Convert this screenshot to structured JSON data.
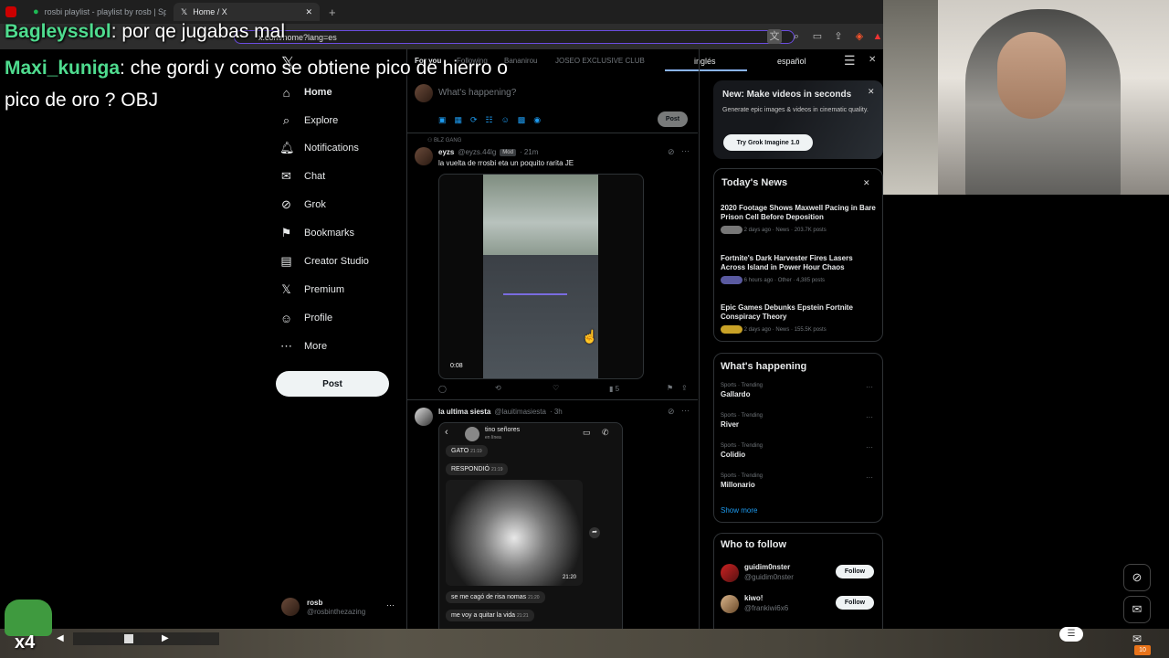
{
  "browser": {
    "tabs": [
      {
        "label": "rosbi playlist - playlist by rosb | Spoti",
        "active": false
      },
      {
        "label": "Home / X",
        "active": true
      }
    ],
    "new_tab": "+",
    "url": "x.com/home?lang=es"
  },
  "chat_overlay": [
    {
      "user": "Bagleysslol",
      "text": ": por qe jugabas mal"
    },
    {
      "user": "Maxi_kuniga",
      "text": ": che gordi y como se obtiene pico de hierro o"
    },
    {
      "user": "",
      "text": "pico de oro ? OBJ"
    }
  ],
  "translate_bar": {
    "from": "inglés",
    "to": "español"
  },
  "nav": {
    "logo": "𝕏",
    "items": [
      {
        "label": "Home",
        "icon": "home-icon",
        "glyph": "⌂"
      },
      {
        "label": "Explore",
        "icon": "search-icon",
        "glyph": "⌕"
      },
      {
        "label": "Notifications",
        "icon": "bell-icon",
        "glyph": "🔔︎"
      },
      {
        "label": "Chat",
        "icon": "message-icon",
        "glyph": "✉"
      },
      {
        "label": "Grok",
        "icon": "grok-icon",
        "glyph": "⊘"
      },
      {
        "label": "Bookmarks",
        "icon": "bookmark-icon",
        "glyph": "⚑"
      },
      {
        "label": "Creator Studio",
        "icon": "creator-icon",
        "glyph": "▤"
      },
      {
        "label": "Premium",
        "icon": "x-premium-icon",
        "glyph": "𝕏"
      },
      {
        "label": "Profile",
        "icon": "profile-icon",
        "glyph": "☺"
      },
      {
        "label": "More",
        "icon": "more-icon",
        "glyph": "⋯"
      }
    ],
    "post_label": "Post",
    "account": {
      "name": "rosb",
      "handle": "@rosbinthezazing",
      "more": "···"
    }
  },
  "feed": {
    "tabs": [
      "For you",
      "Following",
      "Bananirou",
      "JOSEO EXCLUSIVE CLUB"
    ],
    "composer_placeholder": "What's happening?",
    "composer_post": "Post",
    "tweet1": {
      "community": "BLZ GANG",
      "name": "eyzs",
      "handle": "@eyzs.44lg",
      "badge": "Mod",
      "time": "· 21m",
      "text": "la vuelta de rrosbi eta un poquito rarita JE",
      "video_time": "0:08",
      "views": "5"
    },
    "tweet2": {
      "name": "la ultima siesta",
      "handle": "@lauitimasiesta",
      "time": "· 3h",
      "chat_contact": "tino señores",
      "chat_status": "en línea",
      "messages": [
        {
          "text": "GATO",
          "time": "21:19"
        },
        {
          "text": "RESPONDIÓ",
          "time": "21:19"
        }
      ],
      "image_time": "21:20",
      "messages_after": [
        {
          "text": "se me cagó de risa nomas",
          "time": "21:20"
        },
        {
          "text": "me voy a quitar la vida",
          "time": "21:21"
        }
      ]
    }
  },
  "sidebar": {
    "promo": {
      "title": "New: Make videos in seconds",
      "text": "Generate epic images & videos in cinematic quality.",
      "button": "Try Grok Imagine 1.0"
    },
    "news": {
      "title": "Today's News",
      "items": [
        {
          "title": "2020 Footage Shows Maxwell Pacing in Bare Prison Cell Before Deposition",
          "meta": "2 days ago · News · 203.7K posts"
        },
        {
          "title": "Fortnite's Dark Harvester Fires Lasers Across Island in Power Hour Chaos",
          "meta": "6 hours ago · Other · 4,385 posts"
        },
        {
          "title": "Epic Games Debunks Epstein Fortnite Conspiracy Theory",
          "meta": "2 days ago · News · 155.5K posts"
        }
      ]
    },
    "happening": {
      "title": "What's happening",
      "items": [
        {
          "category": "Sports · Trending",
          "name": "Gallardo"
        },
        {
          "category": "Sports · Trending",
          "name": "River"
        },
        {
          "category": "Sports · Trending",
          "name": "Colidio"
        },
        {
          "category": "Sports · Trending",
          "name": "Millonario"
        }
      ],
      "show_more": "Show more"
    },
    "follow": {
      "title": "Who to follow",
      "items": [
        {
          "name": "guidim0nster",
          "handle": "@guidim0nster",
          "button": "Follow"
        },
        {
          "name": "kiwo!",
          "handle": "@frankiwi6x6",
          "button": "Follow"
        }
      ]
    }
  },
  "overlay": {
    "x4": "x4",
    "notification_count": "10"
  }
}
